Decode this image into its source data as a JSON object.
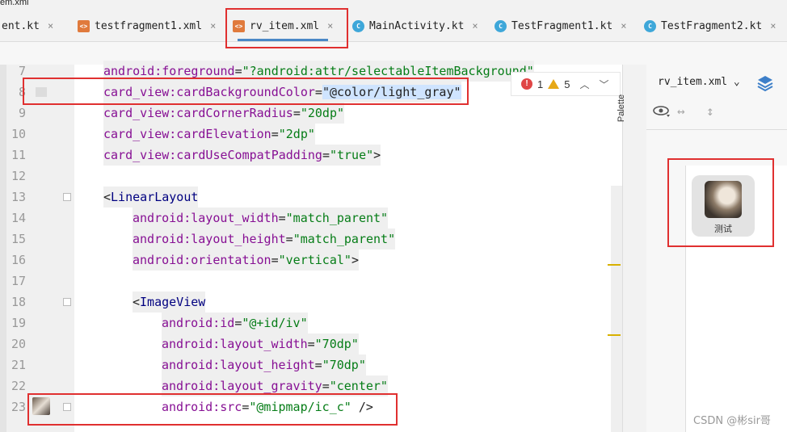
{
  "window": {
    "title_fragment": "em.xml"
  },
  "tabs": [
    {
      "label": "ent.kt",
      "icon": "none",
      "close": "×"
    },
    {
      "label": "testfragment1.xml",
      "icon": "xml",
      "close": "×"
    },
    {
      "label": "rv_item.xml",
      "icon": "xml",
      "close": "×",
      "active": true
    },
    {
      "label": "MainActivity.kt",
      "icon": "kt",
      "close": "×"
    },
    {
      "label": "TestFragment1.kt",
      "icon": "kt",
      "close": "×"
    },
    {
      "label": "TestFragment2.kt",
      "icon": "kt",
      "close": "×"
    }
  ],
  "notifications": {
    "errors": "1",
    "warnings": "5"
  },
  "editor": {
    "lines": [
      {
        "num": "7",
        "indent": 0,
        "parts": [
          [
            "attr",
            "android:foreground"
          ],
          [
            "plain",
            "="
          ],
          [
            "val",
            "\"?android:attr/selectableItemBackground\""
          ]
        ]
      },
      {
        "num": "8",
        "indent": 0,
        "parts": [
          [
            "attr",
            "card_view:cardBackgroundColor"
          ],
          [
            "plain",
            "="
          ],
          [
            "sel",
            "\"@color/light_gray\""
          ]
        ]
      },
      {
        "num": "9",
        "indent": 0,
        "parts": [
          [
            "attr",
            "card_view:cardCornerRadius"
          ],
          [
            "plain",
            "="
          ],
          [
            "val",
            "\"20dp\""
          ]
        ]
      },
      {
        "num": "10",
        "indent": 0,
        "parts": [
          [
            "attr",
            "card_view:cardElevation"
          ],
          [
            "plain",
            "="
          ],
          [
            "val",
            "\"2dp\""
          ]
        ]
      },
      {
        "num": "11",
        "indent": 0,
        "parts": [
          [
            "attr",
            "card_view:cardUseCompatPadding"
          ],
          [
            "plain",
            "="
          ],
          [
            "val",
            "\"true\""
          ],
          [
            "plain",
            ">"
          ]
        ]
      },
      {
        "num": "12",
        "indent": 0,
        "parts": []
      },
      {
        "num": "13",
        "indent": 0,
        "parts": [
          [
            "plain",
            "<"
          ],
          [
            "tag",
            "LinearLayout"
          ]
        ]
      },
      {
        "num": "14",
        "indent": 1,
        "parts": [
          [
            "attr",
            "android:layout_width"
          ],
          [
            "plain",
            "="
          ],
          [
            "val",
            "\"match_parent\""
          ]
        ]
      },
      {
        "num": "15",
        "indent": 1,
        "parts": [
          [
            "attr",
            "android:layout_height"
          ],
          [
            "plain",
            "="
          ],
          [
            "val",
            "\"match_parent\""
          ]
        ]
      },
      {
        "num": "16",
        "indent": 1,
        "parts": [
          [
            "attr",
            "android:orientation"
          ],
          [
            "plain",
            "="
          ],
          [
            "val",
            "\"vertical\""
          ],
          [
            "plain",
            ">"
          ]
        ]
      },
      {
        "num": "17",
        "indent": 0,
        "parts": []
      },
      {
        "num": "18",
        "indent": 1,
        "parts": [
          [
            "plain",
            "<"
          ],
          [
            "tag",
            "ImageView"
          ]
        ]
      },
      {
        "num": "19",
        "indent": 2,
        "parts": [
          [
            "attr",
            "android:id"
          ],
          [
            "plain",
            "="
          ],
          [
            "val",
            "\"@+id/iv\""
          ]
        ]
      },
      {
        "num": "20",
        "indent": 2,
        "parts": [
          [
            "attr",
            "android:layout_width"
          ],
          [
            "plain",
            "="
          ],
          [
            "val",
            "\"70dp\""
          ]
        ]
      },
      {
        "num": "21",
        "indent": 2,
        "parts": [
          [
            "attr",
            "android:layout_height"
          ],
          [
            "plain",
            "="
          ],
          [
            "val",
            "\"70dp\""
          ]
        ]
      },
      {
        "num": "22",
        "indent": 2,
        "parts": [
          [
            "attr",
            "android:layout_gravity"
          ],
          [
            "plain",
            "="
          ],
          [
            "val",
            "\"center\""
          ]
        ]
      },
      {
        "num": "23",
        "indent": 2,
        "parts": [
          [
            "attr",
            "android:src"
          ],
          [
            "plain",
            "="
          ],
          [
            "val",
            "\"@mipmap/ic_c\""
          ],
          [
            "plain",
            " />"
          ]
        ]
      }
    ]
  },
  "palette": {
    "label": "Palette"
  },
  "design": {
    "file_label": "rv_item.xml",
    "dropdown": "⌄",
    "preview_label": "测试"
  },
  "watermark": "CSDN @彬sir哥"
}
